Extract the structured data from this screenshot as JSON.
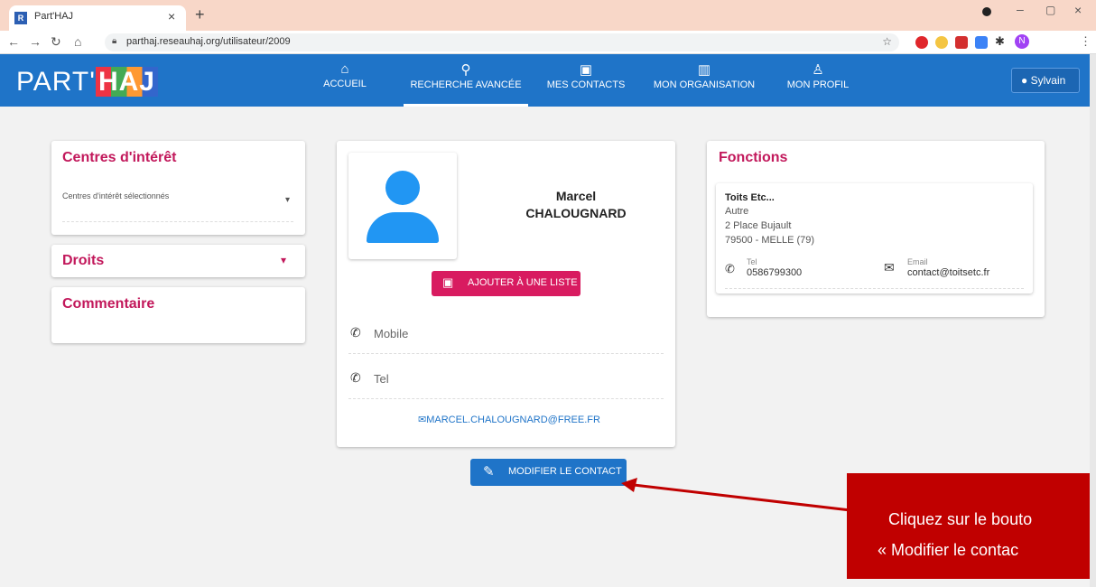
{
  "browser": {
    "tab_title": "Part'HAJ",
    "tab_favicon": "R",
    "url": "parthaj.reseauhaj.org/utilisateur/2009",
    "profile_initial": "N"
  },
  "app": {
    "logo_part": "PART'",
    "logo_haj": "HAJ",
    "user_name": "Sylvain",
    "nav": [
      {
        "label": "ACCUEIL",
        "icon": "home-icon"
      },
      {
        "label": "RECHERCHE AVANCÉE",
        "icon": "search-icon"
      },
      {
        "label": "MES CONTACTS",
        "icon": "contact-card-icon"
      },
      {
        "label": "MON ORGANISATION",
        "icon": "building-icon"
      },
      {
        "label": "MON PROFIL",
        "icon": "person-icon"
      }
    ]
  },
  "left": {
    "interests_title": "Centres d'intérêt",
    "interests_placeholder": "Centres d'intérêt sélectionnés",
    "rights_title": "Droits",
    "comment_title": "Commentaire"
  },
  "contact": {
    "first_name": "Marcel",
    "last_name": "CHALOUGNARD",
    "add_list": "AJOUTER À UNE LISTE",
    "mobile_label": "Mobile",
    "tel_label": "Tel",
    "email": "MARCEL.CHALOUGNARD@FREE.FR"
  },
  "functions": {
    "title": "Fonctions",
    "org": "Toits Etc...",
    "role": "Autre",
    "address1": "2 Place Bujault",
    "address2": "79500 - MELLE (79)",
    "tel_label": "Tel",
    "tel": "0586799300",
    "email_label": "Email",
    "email": "contact@toitsetc.fr"
  },
  "edit_button": "MODIFIER LE CONTACT",
  "callout": {
    "line1": "Cliquez sur le bouto",
    "line2": "« Modifier le contac"
  },
  "colors": {
    "primary": "#1f74c8",
    "accent": "#c2185b",
    "callout": "#c00000"
  }
}
